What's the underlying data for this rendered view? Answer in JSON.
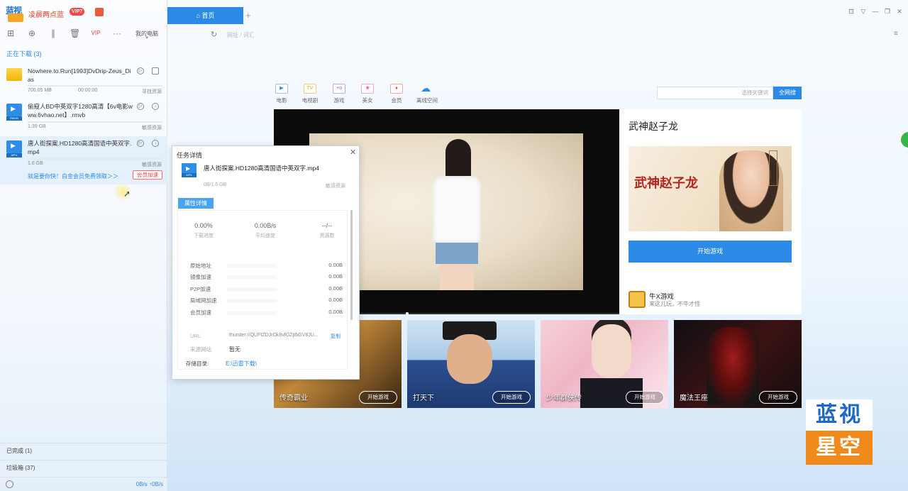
{
  "app": {
    "title": "凌晨两点蓝",
    "vip_badge": "VIP7",
    "logo_text": "蓝视"
  },
  "toolbar": {
    "my_pc": "我的电脑"
  },
  "sidebar": {
    "downloading_label": "正在下载 (3)",
    "completed_label": "已完成 (1)",
    "trash_label": "垃圾箱 (37)",
    "speed": "0B/s  ↑0B/s"
  },
  "downloads": [
    {
      "name": "Nowhere.to.Run[1993]DvDrip-Zeus_Dias",
      "size": "700.05 MB",
      "time": "00:00:00",
      "status": "寻找资源",
      "icon": "folder-icon",
      "progress": 0
    },
    {
      "name": "偷窥人BD中英双字1280高清【6v电影www.6vhao.net】.rmvb",
      "size": "1.39 GB",
      "status": "敏感资源",
      "icon": "video-file-icon",
      "icon_tag": "RMVB",
      "progress": 0
    },
    {
      "name": "唐人街探案.HD1280高清国语中英双字.mp4",
      "size": "1.6 GB",
      "status": "敏感资源",
      "icon": "video-file-icon",
      "icon_tag": "MP4",
      "progress": 0,
      "promo_text": "就是要你快！白金会员免费领取＞＞",
      "promo_button": "会员加速"
    }
  ],
  "browser": {
    "home_tab": "首页",
    "address_placeholder": "网址 / 词汇",
    "search_placeholder": "选择关键词",
    "search_button": "全网搜",
    "categories": [
      {
        "label": "电影",
        "icon": "movie-icon",
        "glyph": "▶"
      },
      {
        "label": "电视剧",
        "icon": "tv-icon",
        "glyph": "TV"
      },
      {
        "label": "游戏",
        "icon": "gamepad-icon",
        "glyph": "+o"
      },
      {
        "label": "美女",
        "icon": "beauty-icon",
        "glyph": "❀"
      },
      {
        "label": "会员",
        "icon": "vip-icon",
        "glyph": "♦"
      },
      {
        "label": "离线空间",
        "icon": "cloud-icon",
        "glyph": "☁"
      }
    ]
  },
  "featured": {
    "title": "武神赵子龙",
    "banner_logo": "武神赵子龙",
    "banner_vertical": "代言人林允儿",
    "start_button": "开始游戏",
    "studio_name": "牛X游戏",
    "studio_tagline": "来这儿玩，不牛才怪"
  },
  "games": [
    {
      "name": "传奇霸业",
      "button": "开始游戏"
    },
    {
      "name": "打天下",
      "button": "开始游戏"
    },
    {
      "name": "少年群侠传",
      "button": "开始游戏"
    },
    {
      "name": "魔法王座",
      "button": "开始游戏"
    }
  ],
  "task_detail": {
    "title": "任务详情",
    "file_name": "唐人街探案.HD1280高清国语中英双字.mp4",
    "file_tag": "MP4",
    "size": "0B/1.6 GB",
    "resource_status": "敏感资源",
    "tab_label": "属性详情",
    "stats": [
      {
        "value": "0.00%",
        "label": "下载进度"
      },
      {
        "value": "0.00B/s",
        "label": "平均速度"
      },
      {
        "value": "--/--",
        "label": "资源数"
      }
    ],
    "accel_rows": [
      {
        "label": "原始地址",
        "value": "0.00B"
      },
      {
        "label": "镜像加速",
        "value": "0.00B"
      },
      {
        "label": "P2P加速",
        "value": "0.00B"
      },
      {
        "label": "局域网加速",
        "value": "0.00B"
      },
      {
        "label": "会员加速",
        "value": "0.00B"
      }
    ],
    "url_label": "URL",
    "url_value": "thunder://QUFIZDJrOk8vfGZpbGV8JU...",
    "copy_label": "复制",
    "source_label": "来源网站",
    "source_value": "暂无",
    "dir_label": "存储目录:",
    "dir_value": "E:\\迅雷下载\\"
  },
  "watermark": {
    "top": "蓝视",
    "bottom": "星空"
  }
}
